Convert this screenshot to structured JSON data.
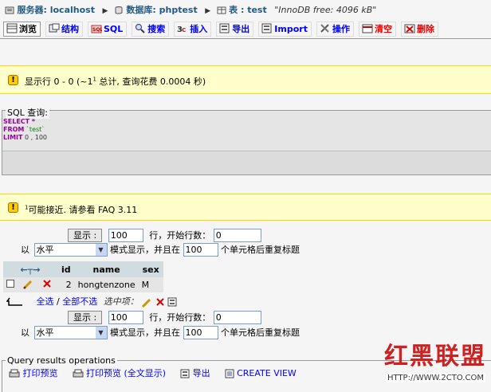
{
  "breadcrumb": {
    "server_label": "服务器: localhost",
    "database_label": "数据库: phptest",
    "table_label": "表 : test",
    "table_comment": "\"InnoDB free: 4096 kB\""
  },
  "tabs": [
    {
      "label": "浏览",
      "icon": "browse-icon",
      "active": true
    },
    {
      "label": "结构",
      "icon": "structure-icon"
    },
    {
      "label": "SQL",
      "icon": "sql-icon"
    },
    {
      "label": "搜索",
      "icon": "search-icon"
    },
    {
      "label": "插入",
      "icon": "insert-icon"
    },
    {
      "label": "导出",
      "icon": "export-icon"
    },
    {
      "label": "Import",
      "icon": "import-icon"
    },
    {
      "label": "操作",
      "icon": "operations-icon"
    },
    {
      "label": "清空",
      "icon": "empty-icon",
      "danger": true
    },
    {
      "label": "删除",
      "icon": "drop-icon",
      "danger": true
    }
  ],
  "notice1": {
    "prefix": "显示行 0 - 0 (~1",
    "sup": "1",
    "suffix": " 总计, 查询花费 0.0004 秒)"
  },
  "sql": {
    "legend": "SQL 查询:",
    "line1_kw": "SELECT",
    "line1_rest": " *",
    "line2_kw": "FROM",
    "line2_rest": " `test`",
    "line3_kw": "LIMIT",
    "line3_rest": " 0 , 100"
  },
  "notice2": {
    "sup": "1",
    "text": "可能接近. 请参看 FAQ 3.11"
  },
  "nav": {
    "show_button": "显示 :",
    "rows_value": "100",
    "rows_text": "行，开始行数：",
    "start_value": "0",
    "mode_prefix": "以",
    "mode_value": "水平",
    "mode_text": "模式显示，并且在",
    "repeat_value": "100",
    "repeat_text": "个单元格后重复标题"
  },
  "table": {
    "headers": [
      "id",
      "name",
      "sex"
    ],
    "rows": [
      {
        "id": "2",
        "name": "hongtenzone",
        "sex": "M"
      }
    ]
  },
  "with_selected": {
    "check_all": "全选",
    "separator": " / ",
    "uncheck_all": "全部不选",
    "label": "选中项："
  },
  "qro": {
    "legend": "Query results operations",
    "links": [
      {
        "label": "打印预览",
        "icon": "print-icon"
      },
      {
        "label": "打印预览 (全文显示)",
        "icon": "print-icon"
      },
      {
        "label": "导出",
        "icon": "export-icon"
      },
      {
        "label": "CREATE VIEW",
        "icon": "view-icon"
      }
    ]
  },
  "watermark": {
    "text": "红黑联盟",
    "url": "HTTP://WWW.2CTO.COM"
  }
}
